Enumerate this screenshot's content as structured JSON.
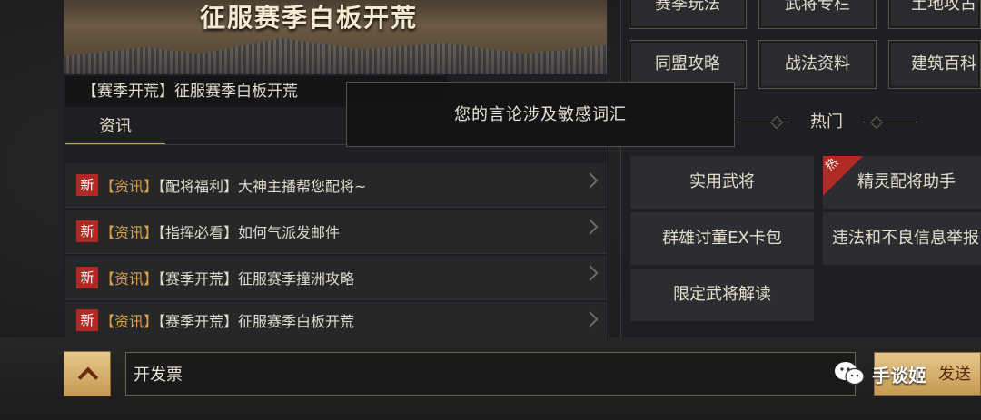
{
  "banner": {
    "title": "征服赛季白板开荒"
  },
  "headline": "【赛季开荒】征服赛季白板开荒",
  "tabs": {
    "news": "资讯"
  },
  "news_list": [
    {
      "badge": "新",
      "category": "【资讯】",
      "text": "【配将福利】大神主播帮您配将~"
    },
    {
      "badge": "新",
      "category": "【资讯】",
      "text": "【指挥必看】如何气派发邮件"
    },
    {
      "badge": "新",
      "category": "【资讯】",
      "text": "【赛季开荒】征服赛季撞洲攻略"
    },
    {
      "badge": "新",
      "category": "【资讯】",
      "text": "【赛季开荒】征服赛季白板开荒"
    }
  ],
  "guide_buttons": [
    "赛季玩法",
    "武将专栏",
    "土地攻占",
    "同盟攻略",
    "战法资料",
    "建筑百科"
  ],
  "hot_section": {
    "title": "热门",
    "buttons": [
      "实用武将",
      "精灵配将助手",
      "群雄讨董EX卡包",
      "违法和不良信息举报",
      "限定武将解读"
    ],
    "flag": "热"
  },
  "toast": "您的言论涉及敏感词汇",
  "chat": {
    "input_value": "开发票",
    "send_label": "发送"
  },
  "watermark": "手谈姬",
  "colors": {
    "accent_gold": "#c9a86b",
    "new_badge": "#b02a24",
    "category_text": "#d9a04a"
  },
  "icons": {
    "collapse": "chevron-up-icon",
    "chevron": "chevron-right-icon",
    "watermark": "wechat-icon"
  }
}
